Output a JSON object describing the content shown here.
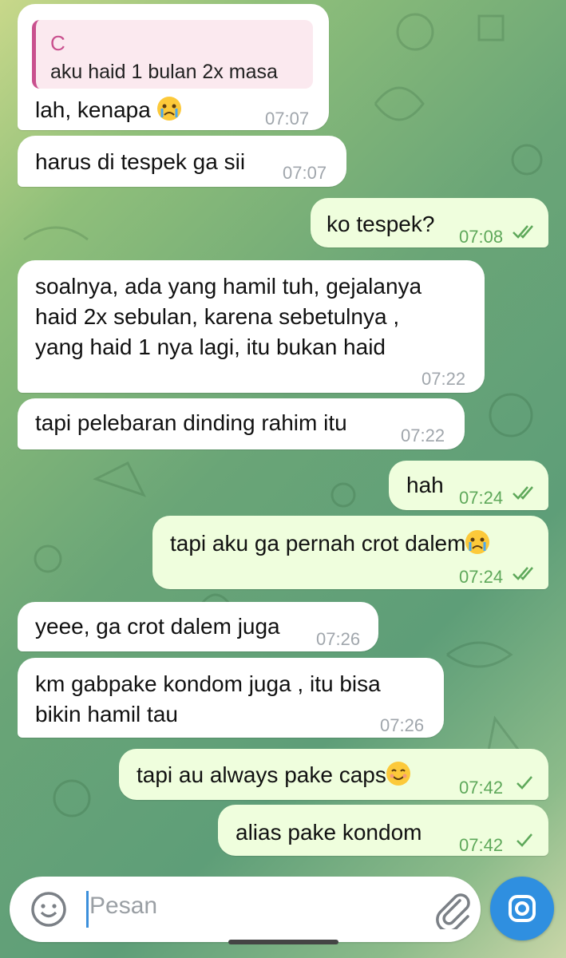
{
  "messages": [
    {
      "dir": "in",
      "reply_name": "C",
      "reply_text": "aku haid 1 bulan 2x masa",
      "text": "lah, kenapa ",
      "emoji": "crying-face",
      "time": "07:07"
    },
    {
      "dir": "in",
      "text": "harus di tespek ga sii",
      "time": "07:07"
    },
    {
      "dir": "out",
      "text": "ko tespek?",
      "time": "07:08",
      "status": "read"
    },
    {
      "dir": "in",
      "text": "soalnya, ada yang hamil tuh, gejalanya\nhaid 2x sebulan, karena sebetulnya ,\nyang haid 1 nya lagi, itu bukan haid",
      "time": "07:22"
    },
    {
      "dir": "in",
      "text": "tapi pelebaran dinding rahim itu",
      "time": "07:22"
    },
    {
      "dir": "out",
      "text": "hah",
      "time": "07:24",
      "status": "read"
    },
    {
      "dir": "out",
      "text": "tapi aku ga pernah crot dalem",
      "emoji": "crying-face",
      "time": "07:24",
      "status": "read"
    },
    {
      "dir": "in",
      "text": "yeee, ga crot dalem juga",
      "time": "07:26"
    },
    {
      "dir": "in",
      "text": "km gabpake kondom juga , itu bisa\nbikin hamil tau",
      "time": "07:26"
    },
    {
      "dir": "out",
      "text": "tapi au always pake caps",
      "emoji": "smiling-face",
      "time": "07:42",
      "status": "sent"
    },
    {
      "dir": "out",
      "text": "alias pake kondom",
      "time": "07:42",
      "status": "sent"
    }
  ],
  "composer": {
    "placeholder": "Pesan"
  },
  "icons": {
    "emoji_button": "smile-icon",
    "attach_button": "paperclip-icon",
    "camera_button": "camera-icon",
    "read_status": "double-check-icon",
    "sent_status": "check-icon"
  },
  "colors": {
    "outgoing_bubble": "#effedd",
    "incoming_bubble": "#ffffff",
    "accent": "#2f8fe0",
    "reply_accent": "#c9508e"
  }
}
